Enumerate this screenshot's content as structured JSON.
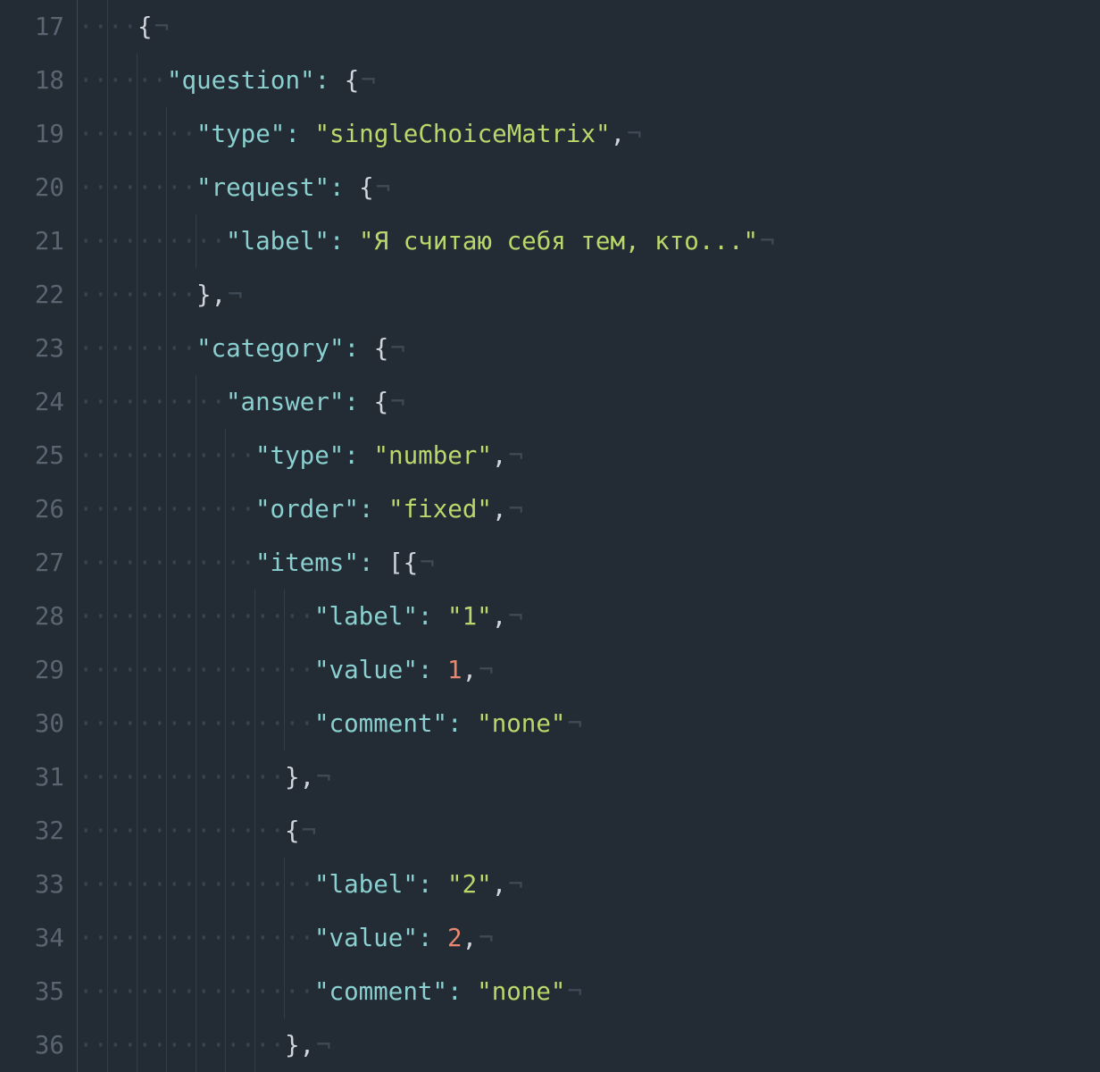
{
  "colors": {
    "background": "#232b34",
    "gutter_fg": "#5a6572",
    "key": "#8bd0d0",
    "string": "#b9d86b",
    "number": "#e7876f",
    "punct": "#d0d5db",
    "invisible": "#3e4a56"
  },
  "editor": {
    "first_line_number": 17,
    "indent_dot": "·",
    "eol_char": "¬"
  },
  "lines": [
    {
      "num": 17,
      "indent": 2,
      "tokens": [
        {
          "t": "{",
          "c": "plain"
        }
      ]
    },
    {
      "num": 18,
      "indent": 3,
      "tokens": [
        {
          "t": "\"question\"",
          "c": "key"
        },
        {
          "t": ":",
          "c": "key"
        },
        {
          "t": " ",
          "c": "plain"
        },
        {
          "t": "{",
          "c": "plain"
        }
      ]
    },
    {
      "num": 19,
      "indent": 4,
      "tokens": [
        {
          "t": "\"type\"",
          "c": "key"
        },
        {
          "t": ":",
          "c": "key"
        },
        {
          "t": " ",
          "c": "plain"
        },
        {
          "t": "\"singleChoiceMatrix\"",
          "c": "str"
        },
        {
          "t": ",",
          "c": "plain"
        }
      ]
    },
    {
      "num": 20,
      "indent": 4,
      "tokens": [
        {
          "t": "\"request\"",
          "c": "key"
        },
        {
          "t": ":",
          "c": "key"
        },
        {
          "t": " ",
          "c": "plain"
        },
        {
          "t": "{",
          "c": "plain"
        }
      ]
    },
    {
      "num": 21,
      "indent": 5,
      "tokens": [
        {
          "t": "\"label\"",
          "c": "key"
        },
        {
          "t": ":",
          "c": "key"
        },
        {
          "t": " ",
          "c": "plain"
        },
        {
          "t": "\"Я считаю себя тем, кто...\"",
          "c": "str"
        }
      ]
    },
    {
      "num": 22,
      "indent": 4,
      "tokens": [
        {
          "t": "}",
          "c": "plain"
        },
        {
          "t": ",",
          "c": "plain"
        }
      ]
    },
    {
      "num": 23,
      "indent": 4,
      "tokens": [
        {
          "t": "\"category\"",
          "c": "key"
        },
        {
          "t": ":",
          "c": "key"
        },
        {
          "t": " ",
          "c": "plain"
        },
        {
          "t": "{",
          "c": "plain"
        }
      ]
    },
    {
      "num": 24,
      "indent": 5,
      "tokens": [
        {
          "t": "\"answer\"",
          "c": "key"
        },
        {
          "t": ":",
          "c": "key"
        },
        {
          "t": " ",
          "c": "plain"
        },
        {
          "t": "{",
          "c": "plain"
        }
      ]
    },
    {
      "num": 25,
      "indent": 6,
      "tokens": [
        {
          "t": "\"type\"",
          "c": "key"
        },
        {
          "t": ":",
          "c": "key"
        },
        {
          "t": " ",
          "c": "plain"
        },
        {
          "t": "\"number\"",
          "c": "str"
        },
        {
          "t": ",",
          "c": "plain"
        }
      ]
    },
    {
      "num": 26,
      "indent": 6,
      "tokens": [
        {
          "t": "\"order\"",
          "c": "key"
        },
        {
          "t": ":",
          "c": "key"
        },
        {
          "t": " ",
          "c": "plain"
        },
        {
          "t": "\"fixed\"",
          "c": "str"
        },
        {
          "t": ",",
          "c": "plain"
        }
      ]
    },
    {
      "num": 27,
      "indent": 6,
      "tokens": [
        {
          "t": "\"items\"",
          "c": "key"
        },
        {
          "t": ":",
          "c": "key"
        },
        {
          "t": " ",
          "c": "plain"
        },
        {
          "t": "[",
          "c": "punct"
        },
        {
          "t": "{",
          "c": "plain"
        }
      ]
    },
    {
      "num": 28,
      "indent": 8,
      "tokens": [
        {
          "t": "\"label\"",
          "c": "key"
        },
        {
          "t": ":",
          "c": "key"
        },
        {
          "t": " ",
          "c": "plain"
        },
        {
          "t": "\"1\"",
          "c": "str"
        },
        {
          "t": ",",
          "c": "plain"
        }
      ]
    },
    {
      "num": 29,
      "indent": 8,
      "tokens": [
        {
          "t": "\"value\"",
          "c": "key"
        },
        {
          "t": ":",
          "c": "key"
        },
        {
          "t": " ",
          "c": "plain"
        },
        {
          "t": "1",
          "c": "num"
        },
        {
          "t": ",",
          "c": "plain"
        }
      ]
    },
    {
      "num": 30,
      "indent": 8,
      "tokens": [
        {
          "t": "\"comment\"",
          "c": "key"
        },
        {
          "t": ":",
          "c": "key"
        },
        {
          "t": " ",
          "c": "plain"
        },
        {
          "t": "\"none\"",
          "c": "str"
        }
      ]
    },
    {
      "num": 31,
      "indent": 7,
      "tokens": [
        {
          "t": "}",
          "c": "plain"
        },
        {
          "t": ",",
          "c": "plain"
        }
      ]
    },
    {
      "num": 32,
      "indent": 7,
      "tokens": [
        {
          "t": "{",
          "c": "plain"
        }
      ]
    },
    {
      "num": 33,
      "indent": 8,
      "tokens": [
        {
          "t": "\"label\"",
          "c": "key"
        },
        {
          "t": ":",
          "c": "key"
        },
        {
          "t": " ",
          "c": "plain"
        },
        {
          "t": "\"2\"",
          "c": "str"
        },
        {
          "t": ",",
          "c": "plain"
        }
      ]
    },
    {
      "num": 34,
      "indent": 8,
      "tokens": [
        {
          "t": "\"value\"",
          "c": "key"
        },
        {
          "t": ":",
          "c": "key"
        },
        {
          "t": " ",
          "c": "plain"
        },
        {
          "t": "2",
          "c": "num"
        },
        {
          "t": ",",
          "c": "plain"
        }
      ]
    },
    {
      "num": 35,
      "indent": 8,
      "tokens": [
        {
          "t": "\"comment\"",
          "c": "key"
        },
        {
          "t": ":",
          "c": "key"
        },
        {
          "t": " ",
          "c": "plain"
        },
        {
          "t": "\"none\"",
          "c": "str"
        }
      ]
    },
    {
      "num": 36,
      "indent": 7,
      "tokens": [
        {
          "t": "}",
          "c": "plain"
        },
        {
          "t": ",",
          "c": "plain"
        }
      ]
    }
  ]
}
